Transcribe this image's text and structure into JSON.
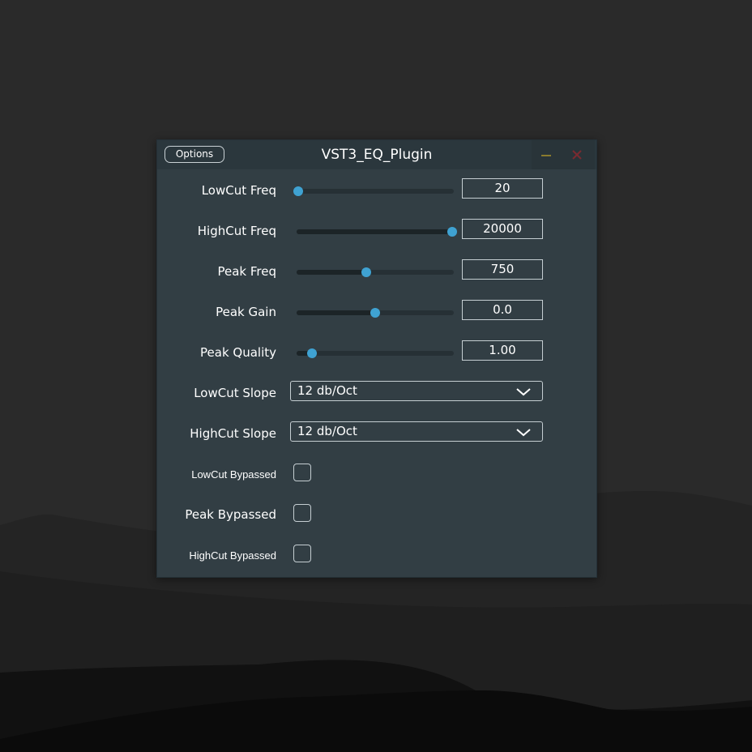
{
  "window": {
    "title": "VST3_EQ_Plugin",
    "options_label": "Options",
    "minimize_icon": "minimize-icon",
    "close_icon": "close-icon"
  },
  "sliders": [
    {
      "label": "LowCut Freq",
      "value": "20",
      "level": 0.0
    },
    {
      "label": "HighCut Freq",
      "value": "20000",
      "level": 1.0
    },
    {
      "label": "Peak Freq",
      "value": "750",
      "level": 0.44
    },
    {
      "label": "Peak Gain",
      "value": "0.0",
      "level": 0.5
    },
    {
      "label": "Peak Quality",
      "value": "1.00",
      "level": 0.09
    }
  ],
  "combos": [
    {
      "label": "LowCut Slope",
      "value": "12 db/Oct",
      "icon": "chevron-down-icon"
    },
    {
      "label": "HighCut Slope",
      "value": "12 db/Oct",
      "icon": "chevron-down-icon"
    }
  ],
  "toggles": [
    {
      "label": "LowCut Bypassed",
      "checked": false
    },
    {
      "label": "Peak Bypassed",
      "checked": false
    },
    {
      "label": "HighCut Bypassed",
      "checked": false
    }
  ],
  "colors": {
    "accent": "#3fa2d2",
    "window_bg": "#323e44",
    "minimize": "#8a7b2e",
    "close": "#7a2a30"
  }
}
